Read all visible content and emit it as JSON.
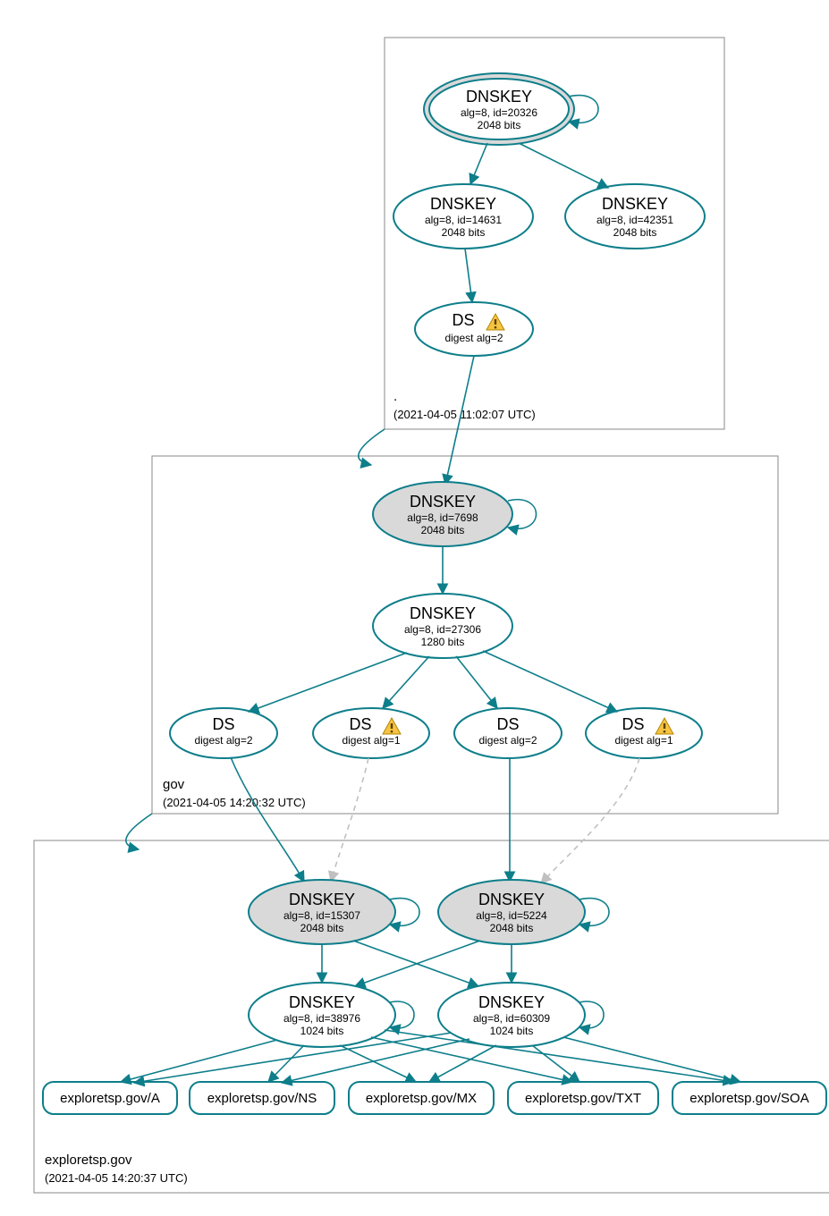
{
  "colors": {
    "stroke": "#0d7e8a",
    "fill_grey": "#d9d9d9"
  },
  "zones": {
    "root": {
      "label": ".",
      "timestamp": "(2021-04-05 11:02:07 UTC)"
    },
    "gov": {
      "label": "gov",
      "timestamp": "(2021-04-05 14:20:32 UTC)"
    },
    "exploretsp": {
      "label": "exploretsp.gov",
      "timestamp": "(2021-04-05 14:20:37 UTC)"
    }
  },
  "nodes": {
    "root_ksk": {
      "title": "DNSKEY",
      "line1": "alg=8, id=20326",
      "line2": "2048 bits"
    },
    "root_zsk1": {
      "title": "DNSKEY",
      "line1": "alg=8, id=14631",
      "line2": "2048 bits"
    },
    "root_zsk2": {
      "title": "DNSKEY",
      "line1": "alg=8, id=42351",
      "line2": "2048 bits"
    },
    "root_ds": {
      "title": "DS",
      "line1": "digest alg=2",
      "warn": true
    },
    "gov_ksk": {
      "title": "DNSKEY",
      "line1": "alg=8, id=7698",
      "line2": "2048 bits"
    },
    "gov_zsk": {
      "title": "DNSKEY",
      "line1": "alg=8, id=27306",
      "line2": "1280 bits"
    },
    "gov_ds1": {
      "title": "DS",
      "line1": "digest alg=2"
    },
    "gov_ds2": {
      "title": "DS",
      "line1": "digest alg=1",
      "warn": true
    },
    "gov_ds3": {
      "title": "DS",
      "line1": "digest alg=2"
    },
    "gov_ds4": {
      "title": "DS",
      "line1": "digest alg=1",
      "warn": true
    },
    "ex_ksk1": {
      "title": "DNSKEY",
      "line1": "alg=8, id=15307",
      "line2": "2048 bits"
    },
    "ex_ksk2": {
      "title": "DNSKEY",
      "line1": "alg=8, id=5224",
      "line2": "2048 bits"
    },
    "ex_zsk1": {
      "title": "DNSKEY",
      "line1": "alg=8, id=38976",
      "line2": "1024 bits"
    },
    "ex_zsk2": {
      "title": "DNSKEY",
      "line1": "alg=8, id=60309",
      "line2": "1024 bits"
    }
  },
  "records": {
    "a": "exploretsp.gov/A",
    "ns": "exploretsp.gov/NS",
    "mx": "exploretsp.gov/MX",
    "txt": "exploretsp.gov/TXT",
    "soa": "exploretsp.gov/SOA"
  }
}
